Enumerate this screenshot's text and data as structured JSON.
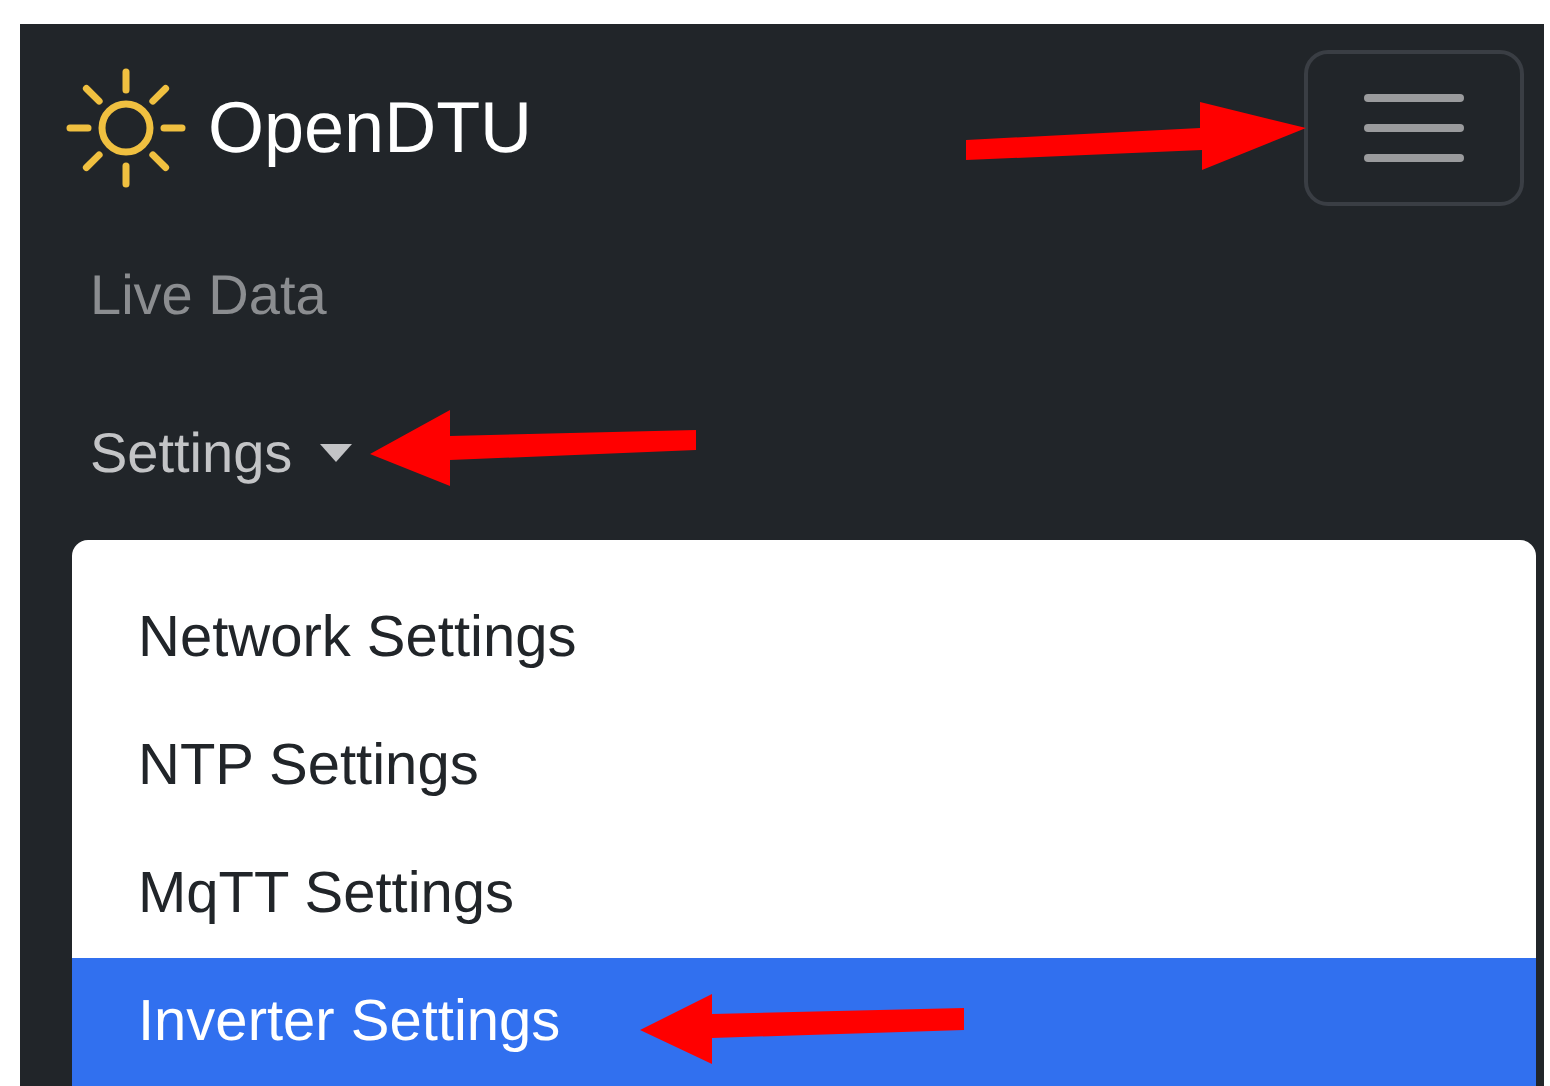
{
  "brand": {
    "title": "OpenDTU"
  },
  "menu_button": {
    "expanded": true
  },
  "nav_links": [
    {
      "label": "Live Data",
      "kind": "link"
    },
    {
      "label": "Settings",
      "kind": "dropdown",
      "expanded": true
    }
  ],
  "dropdown_items": [
    {
      "label": "Network Settings",
      "selected": false
    },
    {
      "label": "NTP Settings",
      "selected": false
    },
    {
      "label": "MqTT Settings",
      "selected": false
    },
    {
      "label": "Inverter Settings",
      "selected": true
    }
  ]
}
